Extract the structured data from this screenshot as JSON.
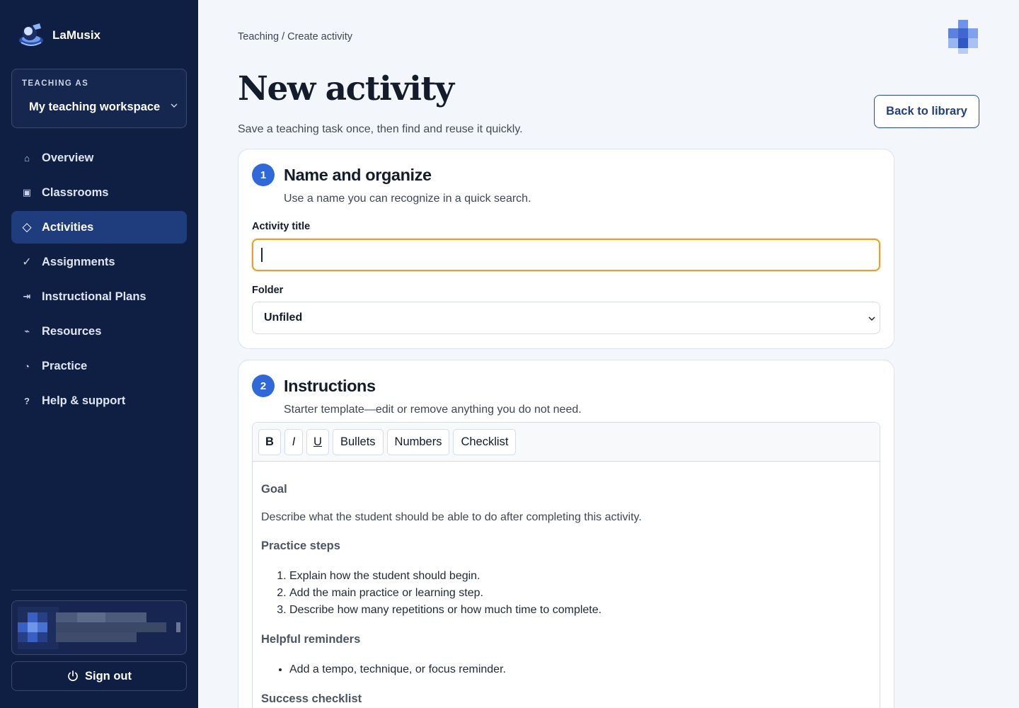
{
  "app": {
    "name": "LaMusix"
  },
  "sidebar": {
    "workspace": {
      "label": "TEACHING AS",
      "value": "My teaching workspace"
    },
    "items": [
      {
        "label": "Overview",
        "icon": "home-icon",
        "glyph": "⌂"
      },
      {
        "label": "Classrooms",
        "icon": "classroom-icon",
        "glyph": "▣"
      },
      {
        "label": "Activities",
        "icon": "diamond-icon",
        "glyph": "◇",
        "active": true
      },
      {
        "label": "Assignments",
        "icon": "check-icon",
        "glyph": "✓"
      },
      {
        "label": "Instructional Plans",
        "icon": "arrow-to-bar-icon",
        "glyph": "⇥"
      },
      {
        "label": "Resources",
        "icon": "resources-icon",
        "glyph": "⌁"
      },
      {
        "label": "Practice",
        "icon": "timer-icon",
        "glyph": "◔"
      },
      {
        "label": "Help & support",
        "icon": "help-icon",
        "glyph": "?"
      }
    ],
    "signout_label": "Sign out"
  },
  "header": {
    "breadcrumb": "Teaching / Create activity",
    "title": "New activity",
    "subtitle": "Save a teaching task once, then find and reuse it quickly.",
    "back_label": "Back to library"
  },
  "section1": {
    "step": "1",
    "title": "Name and organize",
    "subtitle": "Use a name you can recognize in a quick search.",
    "title_label": "Activity title",
    "title_value": "",
    "folder_label": "Folder",
    "folder_value": "Unfiled"
  },
  "section2": {
    "step": "2",
    "title": "Instructions",
    "subtitle": "Starter template—edit or remove anything you do not need.",
    "toolbar": {
      "bold": "B",
      "italic": "I",
      "underline": "U",
      "bullets": "Bullets",
      "numbers": "Numbers",
      "checklist": "Checklist"
    },
    "content": {
      "goal_heading": "Goal",
      "goal_text": "Describe what the student should be able to do after completing this activity.",
      "steps_heading": "Practice steps",
      "steps": [
        "Explain how the student should begin.",
        "Add the main practice or learning step.",
        "Describe how many repetitions or how much time to complete."
      ],
      "reminders_heading": "Helpful reminders",
      "reminders": [
        "Add a tempo, technique, or focus reminder."
      ],
      "checklist_heading": "Success checklist"
    }
  },
  "colors": {
    "sidebar_bg": "#0f1e43",
    "active_item": "#1f3d7c",
    "accent": "#2f68d8",
    "focus_ring": "#e2a233"
  }
}
